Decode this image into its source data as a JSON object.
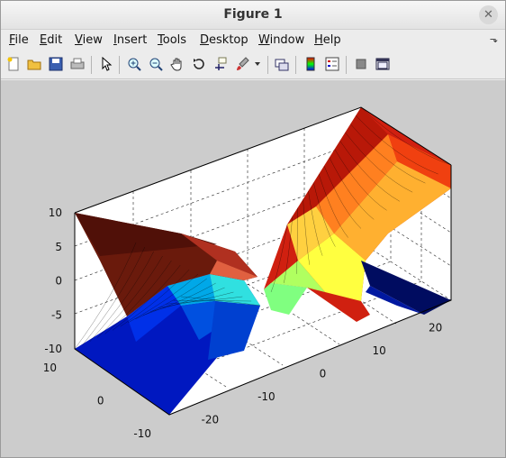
{
  "window": {
    "title": "Figure 1"
  },
  "menu": [
    {
      "label": "File",
      "accel": "F",
      "rest": "ile"
    },
    {
      "label": "Edit",
      "accel": "E",
      "rest": "dit"
    },
    {
      "label": "View",
      "accel": "V",
      "rest": "iew"
    },
    {
      "label": "Insert",
      "accel": "I",
      "rest": "nsert"
    },
    {
      "label": "Tools",
      "accel": "T",
      "rest": "ools"
    },
    {
      "label": "Desktop",
      "accel": "D",
      "rest": "esktop"
    },
    {
      "label": "Window",
      "accel": "W",
      "rest": "indow"
    },
    {
      "label": "Help",
      "accel": "H",
      "rest": "elp"
    }
  ],
  "toolbar": {
    "buttons": [
      "new-figure-icon",
      "open-file-icon",
      "save-icon",
      "print-icon",
      "select-arrow-icon",
      "zoom-in-icon",
      "zoom-out-icon",
      "pan-hand-icon",
      "rotate-3d-icon",
      "data-cursor-icon",
      "brush-icon",
      "colorbar-icon",
      "legend-icon",
      "hide-plot-tools-icon",
      "show-plot-tools-icon",
      "link-plot-icon"
    ]
  },
  "chart_data": {
    "type": "surface",
    "title": "",
    "xlabel": "",
    "ylabel": "",
    "zlabel": "",
    "x_ticks": [
      "-20",
      "-10",
      "0",
      "10",
      "20"
    ],
    "y_ticks": [
      "-10",
      "0",
      "10"
    ],
    "z_ticks": [
      "-10",
      "-5",
      "0",
      "5",
      "10"
    ],
    "xlim": [
      -25,
      25
    ],
    "ylim": [
      -10,
      10
    ],
    "zlim": [
      -10,
      10
    ],
    "colormap": "jet",
    "grid": true,
    "function": "z = arctan-like surface with discontinuity along y = x/2 line (two sheets)",
    "colors": {
      "low": "#00008f",
      "mid": "#7fff7f",
      "high": "#8f0000",
      "background": "#cccccc"
    }
  }
}
